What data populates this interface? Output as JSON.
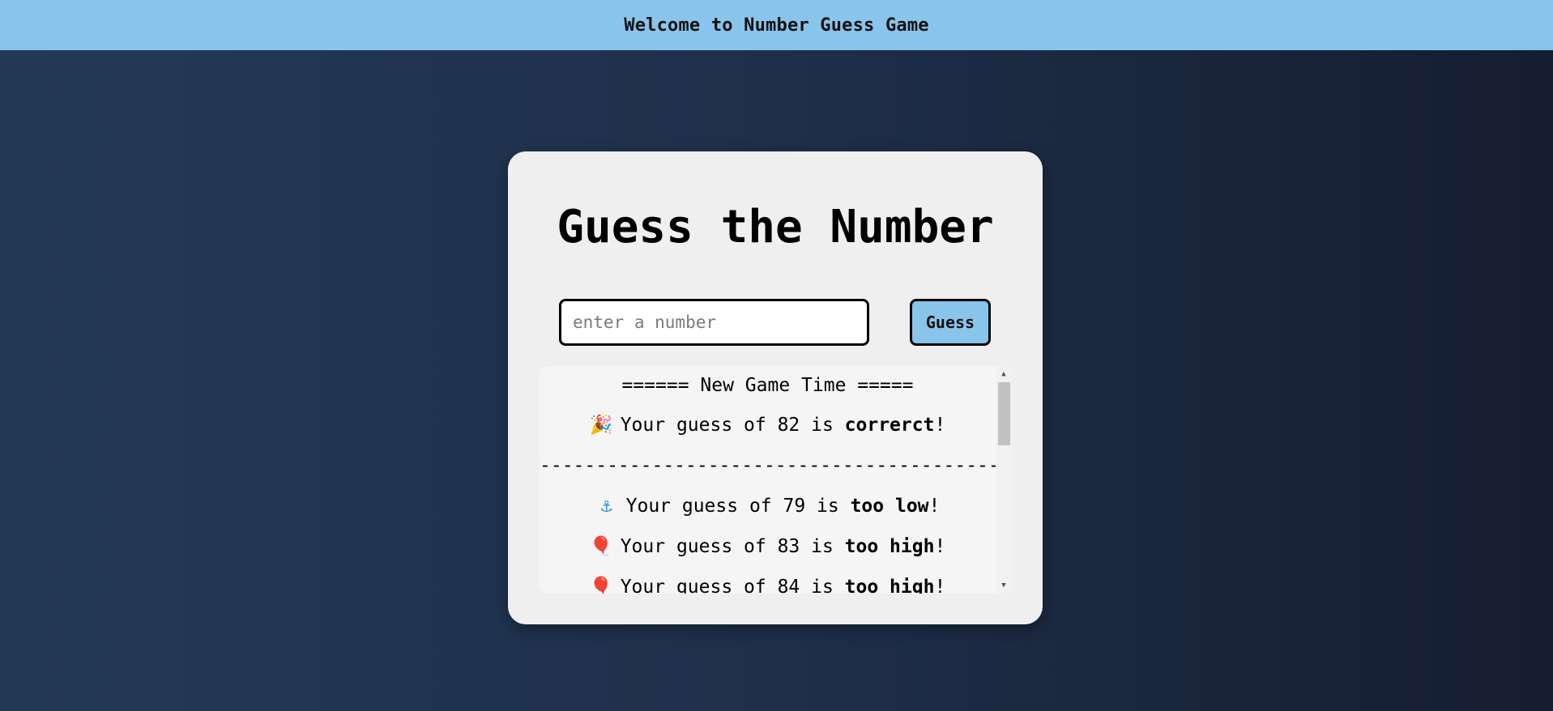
{
  "header": {
    "title": "Welcome to Number Guess Game"
  },
  "game": {
    "title": "Guess the Number",
    "input": {
      "placeholder": "enter a number",
      "value": ""
    },
    "guess_button_label": "Guess"
  },
  "log": {
    "new_game_line": "====== New Game Time =====",
    "divider": "-------------------------------------------------------",
    "entries": [
      {
        "icon": "party-popper-icon",
        "glyph": "🎉",
        "prefix": "Your guess of 82 is ",
        "result": "correrct",
        "suffix": "!"
      },
      {
        "icon": "anchor-icon",
        "glyph": "⚓",
        "prefix": "Your guess of 79 is ",
        "result": "too low",
        "suffix": "!"
      },
      {
        "icon": "balloon-icon",
        "glyph": "🎈",
        "prefix": "Your guess of 83 is ",
        "result": "too high",
        "suffix": "!"
      },
      {
        "icon": "balloon-icon",
        "glyph": "🎈",
        "prefix": "Your guess of 84 is ",
        "result": "too high",
        "suffix": "!"
      }
    ]
  },
  "colors": {
    "header_bg": "#89c4eb",
    "button_bg": "#89c4eb",
    "card_bg": "#efefef",
    "page_bg_left": "#233a56",
    "page_bg_right": "#151d30"
  }
}
